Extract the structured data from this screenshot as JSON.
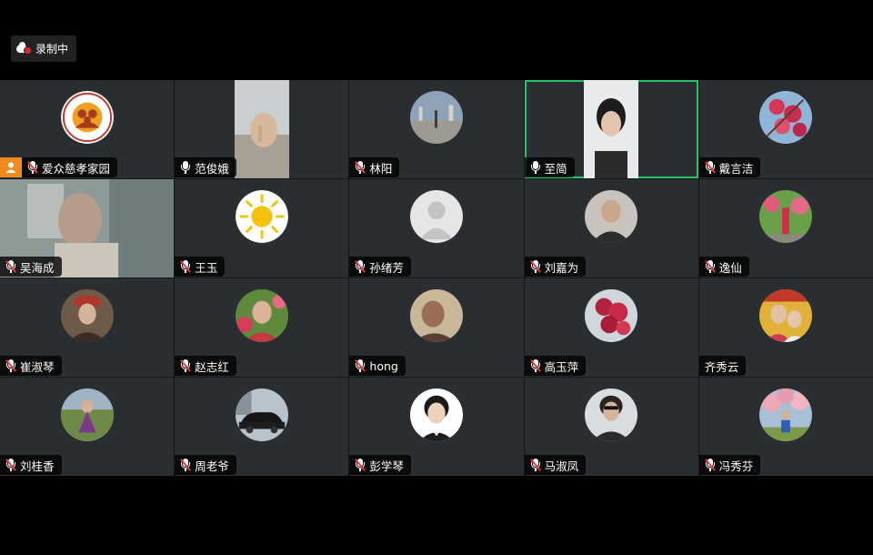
{
  "recording": {
    "label": "录制中",
    "icon": "cloud-record-icon"
  },
  "tiles": [
    {
      "name": "爱众慈孝家园",
      "muted": true,
      "host": true
    },
    {
      "name": "范俊娥",
      "muted": false
    },
    {
      "name": "林阳",
      "muted": true
    },
    {
      "name": "至简",
      "muted": false,
      "active": true
    },
    {
      "name": "戴言洁",
      "muted": true
    },
    {
      "name": "吴海成",
      "muted": true
    },
    {
      "name": "王玉",
      "muted": true
    },
    {
      "name": "孙绪芳",
      "muted": true
    },
    {
      "name": "刘嘉为",
      "muted": true
    },
    {
      "name": "逸仙",
      "muted": true
    },
    {
      "name": "崔淑琴",
      "muted": true
    },
    {
      "name": "赵志红",
      "muted": true
    },
    {
      "name": "hong",
      "muted": true
    },
    {
      "name": "高玉萍",
      "muted": true
    },
    {
      "name": "齐秀云",
      "muted": null
    },
    {
      "name": "刘桂香",
      "muted": true
    },
    {
      "name": "周老爷",
      "muted": true
    },
    {
      "name": "彭学琴",
      "muted": true
    },
    {
      "name": "马淑凤",
      "muted": true
    },
    {
      "name": "冯秀芬",
      "muted": true
    }
  ],
  "colors": {
    "tile_bg": "#2b2e31",
    "active_border": "#27c26a",
    "host_badge": "#f28b1c",
    "mute_slash": "#e83b3b"
  }
}
